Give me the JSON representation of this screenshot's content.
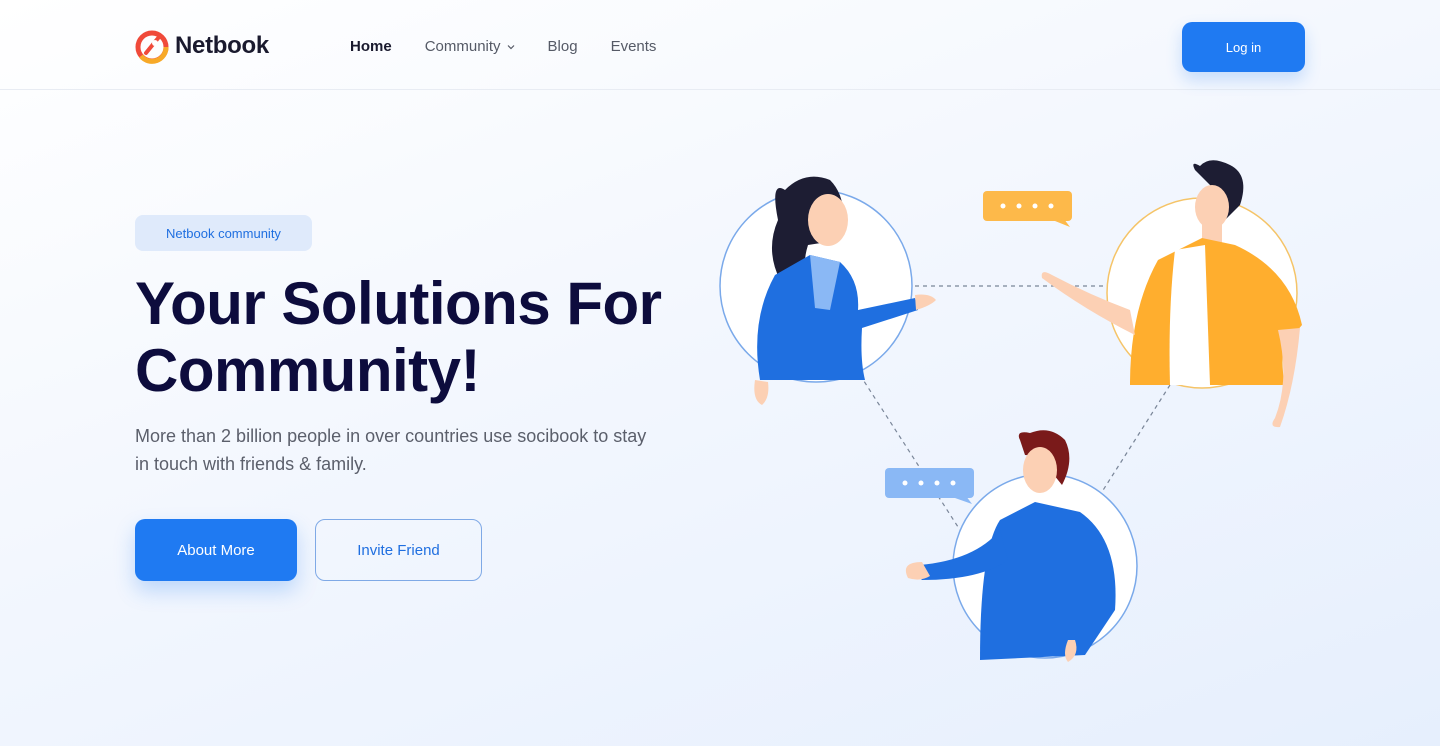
{
  "brand": {
    "name": "Netbook"
  },
  "nav": {
    "items": [
      {
        "label": "Home",
        "active": true
      },
      {
        "label": "Community",
        "has_dropdown": true
      },
      {
        "label": "Blog"
      },
      {
        "label": "Events"
      }
    ],
    "login_label": "Log in"
  },
  "hero": {
    "badge": "Netbook community",
    "title_line1": "Your Solutions For",
    "title_line2": "Community!",
    "subtitle": "More than 2 billion people in over countries use socibook to stay in touch with friends & family.",
    "primary_button": "About More",
    "secondary_button": "Invite Friend"
  },
  "colors": {
    "accent": "#1f7af2",
    "title": "#0d0c3d",
    "bubble_yellow": "#fdb94a",
    "bubble_blue": "#8ab8f5",
    "jacket_yellow": "#ffae2e",
    "shirt_blue": "#1f6fe0"
  },
  "icons": [
    "logo-icon",
    "chevron-down-icon",
    "chat-bubble-icon"
  ]
}
